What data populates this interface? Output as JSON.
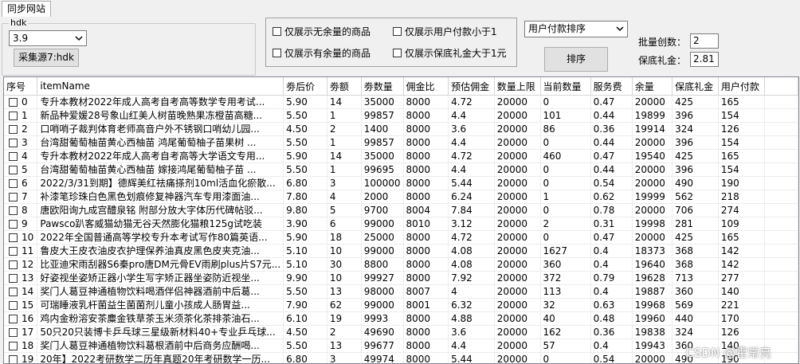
{
  "tabs": [
    {
      "label": "同步网站"
    }
  ],
  "group": {
    "legend": "hdk",
    "site_select": "3.9",
    "collect_button": "采集源7:hdk"
  },
  "filters": {
    "no_stock": "仅展示无余量的商品",
    "has_stock": "仅展示有余量的商品",
    "user_pay_lt": "仅展示用户付款小于1",
    "guarantee_gt": "仅展示保底礼金大于1元"
  },
  "sort": {
    "select": "用户付款排序",
    "button": "排序"
  },
  "batch": {
    "create_label": "批量创数：",
    "create_value": "2",
    "guarantee_label": "保底礼金：",
    "guarantee_value": "2.81"
  },
  "table": {
    "columns": [
      "序号",
      "itemName",
      "劵后价",
      "劵额",
      "劵数量",
      "佣金比",
      "预估佣金",
      "数量上限",
      "当前数量",
      "服务费",
      "余量",
      "保底礼金",
      "用户付款"
    ],
    "rows": [
      [
        "0",
        "专升本教材2022年成人高考自考高等数学专用考试...",
        "5.90",
        "14",
        "35000",
        "8000",
        "4.72",
        "20000",
        "0",
        "0.47",
        "20000",
        "425",
        "165"
      ],
      [
        "1",
        "新品种爱媛28号象山红美人树苗晚熟果冻橙苗高糖...",
        "5.50",
        "1",
        "99857",
        "8000",
        "4.4",
        "20000",
        "101",
        "0.44",
        "19899",
        "396",
        "154"
      ],
      [
        "2",
        "口哨哨子裁判体育老师高音户外不锈钢口哨幼儿园...",
        "4.50",
        "2",
        "1400",
        "8000",
        "3.6",
        "20000",
        "86",
        "0.36",
        "19914",
        "324",
        "126"
      ],
      [
        "3",
        "台湾甜葡萄柚苗黄心西柚苗 鸿尾葡萄柚子苗果树 ...",
        "5.50",
        "1",
        "99857",
        "8000",
        "4.4",
        "20000",
        "0",
        "0.44",
        "20000",
        "396",
        "154"
      ],
      [
        "4",
        "专升本教材2022年成人高考自考高等大学语文专用...",
        "5.90",
        "14",
        "35000",
        "8000",
        "4.72",
        "20000",
        "460",
        "0.47",
        "19540",
        "425",
        "165"
      ],
      [
        "5",
        "台湾甜葡萄柚苗黄心西柚苗 嫁接鸿尾葡萄柚子苗 ...",
        "5.50",
        "1",
        "99695",
        "8000",
        "4.4",
        "20000",
        "0",
        "0.44",
        "20000",
        "396",
        "154"
      ],
      [
        "6",
        "2022/3/31到期】德辉美红祛痛搽剂10ml活血化瘀散...",
        "6.80",
        "3",
        "100000",
        "8000",
        "5.44",
        "20000",
        "0",
        "0.54",
        "20000",
        "490",
        "190"
      ],
      [
        "7",
        "补漆笔珍珠白色黑色划痕修复神器汽车专用漆面油...",
        "7.80",
        "4",
        "2000",
        "8000",
        "6.24",
        "20000",
        "1",
        "0.62",
        "19999",
        "562",
        "218"
      ],
      [
        "8",
        "唐欧阳询九成宫醴泉铭 附部分放大字体历代碑帖驳...",
        "9.80",
        "5",
        "9700",
        "8004",
        "7.84",
        "20000",
        "0",
        "0.78",
        "20000",
        "706",
        "274"
      ],
      [
        "9",
        "Pawsco趴客威猫幼猫无谷天然膨化猫粮125g试吃装",
        "3.90",
        "6",
        "99000",
        "8010",
        "3.12",
        "20000",
        "2",
        "0.31",
        "19998",
        "281",
        "109"
      ],
      [
        "10",
        "2022年全国普通高等学校专升本考试写作80篇英语...",
        "5.90",
        "18",
        "25000",
        "8000",
        "4.72",
        "20000",
        "0",
        "0.47",
        "20000",
        "425",
        "165"
      ],
      [
        "11",
        "鲁皮大王皮衣油皮衣护理保养油真皮黑色皮夹克油...",
        "5.10",
        "10",
        "99000",
        "8000",
        "4.08",
        "20000",
        "1627",
        "0.4",
        "18373",
        "368",
        "142"
      ],
      [
        "12",
        "比亚迪宋雨刮器S6秦pro唐DM元骨EV雨刷plus片S7元...",
        "5.10",
        "30",
        "8800",
        "8000",
        "4.08",
        "20000",
        "360",
        "0.4",
        "19640",
        "368",
        "142"
      ],
      [
        "13",
        "好姿视坐姿矫正器小学生写字矫正器坐姿防近视坐...",
        "9.90",
        "10",
        "99927",
        "8000",
        "7.92",
        "20000",
        "372",
        "0.79",
        "19628",
        "713",
        "277"
      ],
      [
        "14",
        "奖门人葛豆神通植物饮料喝酒伴侣神器酒前中后葛...",
        "5.50",
        "13",
        "98000",
        "8007",
        "4",
        "20000",
        "113",
        "0.4",
        "19887",
        "360",
        "140"
      ],
      [
        "15",
        "可瑞睡液乳杆菌益生菌菌剂儿童小孩成人肠胃益...",
        "7.90",
        "62",
        "99000",
        "8001",
        "6.32",
        "20000",
        "32",
        "0.63",
        "19968",
        "569",
        "221"
      ],
      [
        "16",
        "鸡内金粉溶安茶麋金铁草茶玉米须茶化茶排茶油石...",
        "6.10",
        "19",
        "9993",
        "8000",
        "4.88",
        "20000",
        "40",
        "0.48",
        "19960",
        "440",
        "170"
      ],
      [
        "17",
        "50只20只装博卡乒乓球三星级新材料40+专业乒乓球...",
        "4.50",
        "2",
        "49690",
        "8000",
        "3.6",
        "20000",
        "162",
        "0.36",
        "19838",
        "324",
        "126"
      ],
      [
        "18",
        "奖门人葛豆神通植物饮料葛根酒前中后商务应酬喝...",
        "5.50",
        "13",
        "99677",
        "8000",
        "4.4",
        "20000",
        "57",
        "0.4",
        "19943",
        "360",
        "140"
      ],
      [
        "19",
        "20年】2022考研数学二历年真题20年考研数学一历...",
        "6.80",
        "3",
        "49974",
        "8000",
        "5.44",
        "20000",
        "0",
        "0.54",
        "20000",
        "490",
        "190"
      ]
    ]
  },
  "watermark": "CSDN @霍常亮",
  "icons": {
    "dropdown": "chevron-down-icon",
    "checkbox": "checkbox-icon"
  }
}
